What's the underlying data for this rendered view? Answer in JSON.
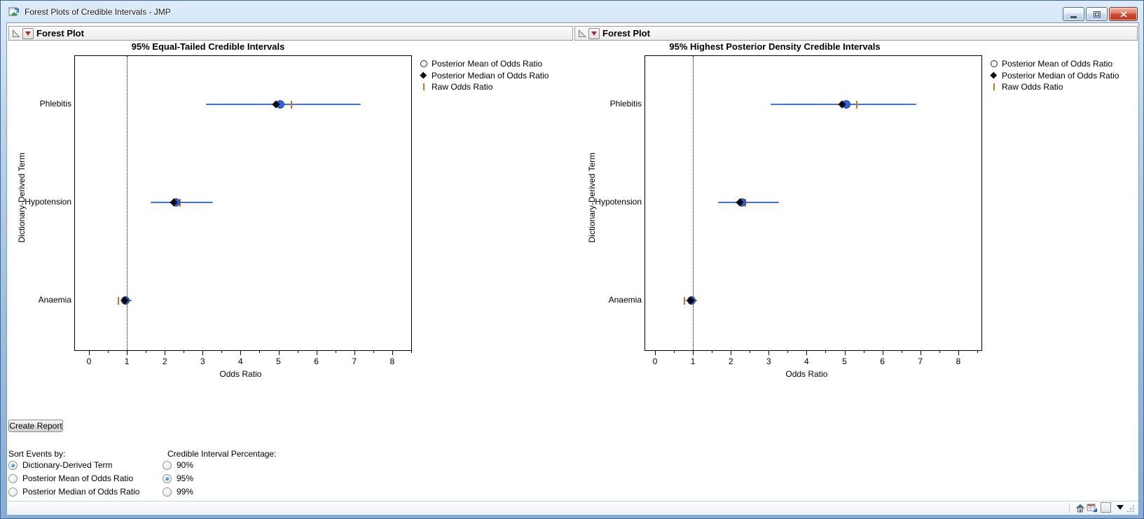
{
  "window": {
    "title": "Forest Plots of Credible Intervals - JMP"
  },
  "panels": [
    {
      "header": "Forest Plot"
    },
    {
      "header": "Forest Plot"
    }
  ],
  "colors": {
    "interval_blue": "#4070E8",
    "mean_fill": "#2E62E0",
    "median_black": "#0A0A0A",
    "raw_orange": "#C9731F",
    "reference_line": "#000000"
  },
  "chart_data": [
    {
      "type": "forest",
      "title": "95% Equal-Tailed Credible Intervals",
      "xlabel": "Odds Ratio",
      "ylabel": "Dictionary-Derived Term",
      "xlim": [
        -0.39,
        8.52
      ],
      "xticks": [
        0,
        1,
        2,
        3,
        4,
        5,
        6,
        7,
        8
      ],
      "minor_tick_step": 0.5,
      "reference_line_x": 1,
      "grid": false,
      "legend_position": "right",
      "categories": [
        "Phlebitis",
        "Hypotension",
        "Anaemia"
      ],
      "series": [
        {
          "term": "Phlebitis",
          "lower": 3.08,
          "upper": 7.17,
          "mean": 5.05,
          "median": 4.93,
          "raw": 5.35
        },
        {
          "term": "Hypotension",
          "lower": 1.63,
          "upper": 3.27,
          "mean": 2.3,
          "median": 2.24,
          "raw": 2.4
        },
        {
          "term": "Anaemia",
          "lower": 0.83,
          "upper": 1.12,
          "mean": 0.97,
          "median": 0.95,
          "raw": 0.78
        }
      ],
      "legend": [
        {
          "marker": "open-circle",
          "label": "Posterior Mean of Odds Ratio"
        },
        {
          "marker": "filled-diamond",
          "label": "Posterior Median of Odds Ratio"
        },
        {
          "marker": "orange-tick",
          "label": "Raw Odds Ratio"
        }
      ]
    },
    {
      "type": "forest",
      "title": "95% Highest Posterior Density Credible Intervals",
      "xlabel": "Odds Ratio",
      "ylabel": "Dictionary-Derived Term",
      "xlim": [
        -0.28,
        8.63
      ],
      "xticks": [
        0,
        1,
        2,
        3,
        4,
        5,
        6,
        7,
        8
      ],
      "minor_tick_step": 0.5,
      "reference_line_x": 1,
      "grid": false,
      "legend_position": "right",
      "categories": [
        "Phlebitis",
        "Hypotension",
        "Anaemia"
      ],
      "series": [
        {
          "term": "Phlebitis",
          "lower": 3.05,
          "upper": 6.9,
          "mean": 5.04,
          "median": 4.93,
          "raw": 5.32
        },
        {
          "term": "Hypotension",
          "lower": 1.66,
          "upper": 3.28,
          "mean": 2.29,
          "median": 2.24,
          "raw": 2.39
        },
        {
          "term": "Anaemia",
          "lower": 0.81,
          "upper": 1.1,
          "mean": 0.97,
          "median": 0.95,
          "raw": 0.78
        }
      ],
      "legend": [
        {
          "marker": "open-circle",
          "label": "Posterior Mean of Odds Ratio"
        },
        {
          "marker": "filled-diamond",
          "label": "Posterior Median of Odds Ratio"
        },
        {
          "marker": "orange-tick",
          "label": "Raw Odds Ratio"
        }
      ]
    }
  ],
  "controls": {
    "create_report": "Create Report",
    "sort_group": {
      "label": "Sort Events by:",
      "options": [
        {
          "label": "Dictionary-Derived Term",
          "selected": true
        },
        {
          "label": "Posterior Mean of Odds Ratio",
          "selected": false
        },
        {
          "label": "Posterior Median of Odds Ratio",
          "selected": false
        }
      ]
    },
    "ci_group": {
      "label": "Credible Interval Percentage:",
      "options": [
        {
          "label": "90%",
          "selected": false
        },
        {
          "label": "95%",
          "selected": true
        },
        {
          "label": "99%",
          "selected": false
        }
      ]
    }
  }
}
